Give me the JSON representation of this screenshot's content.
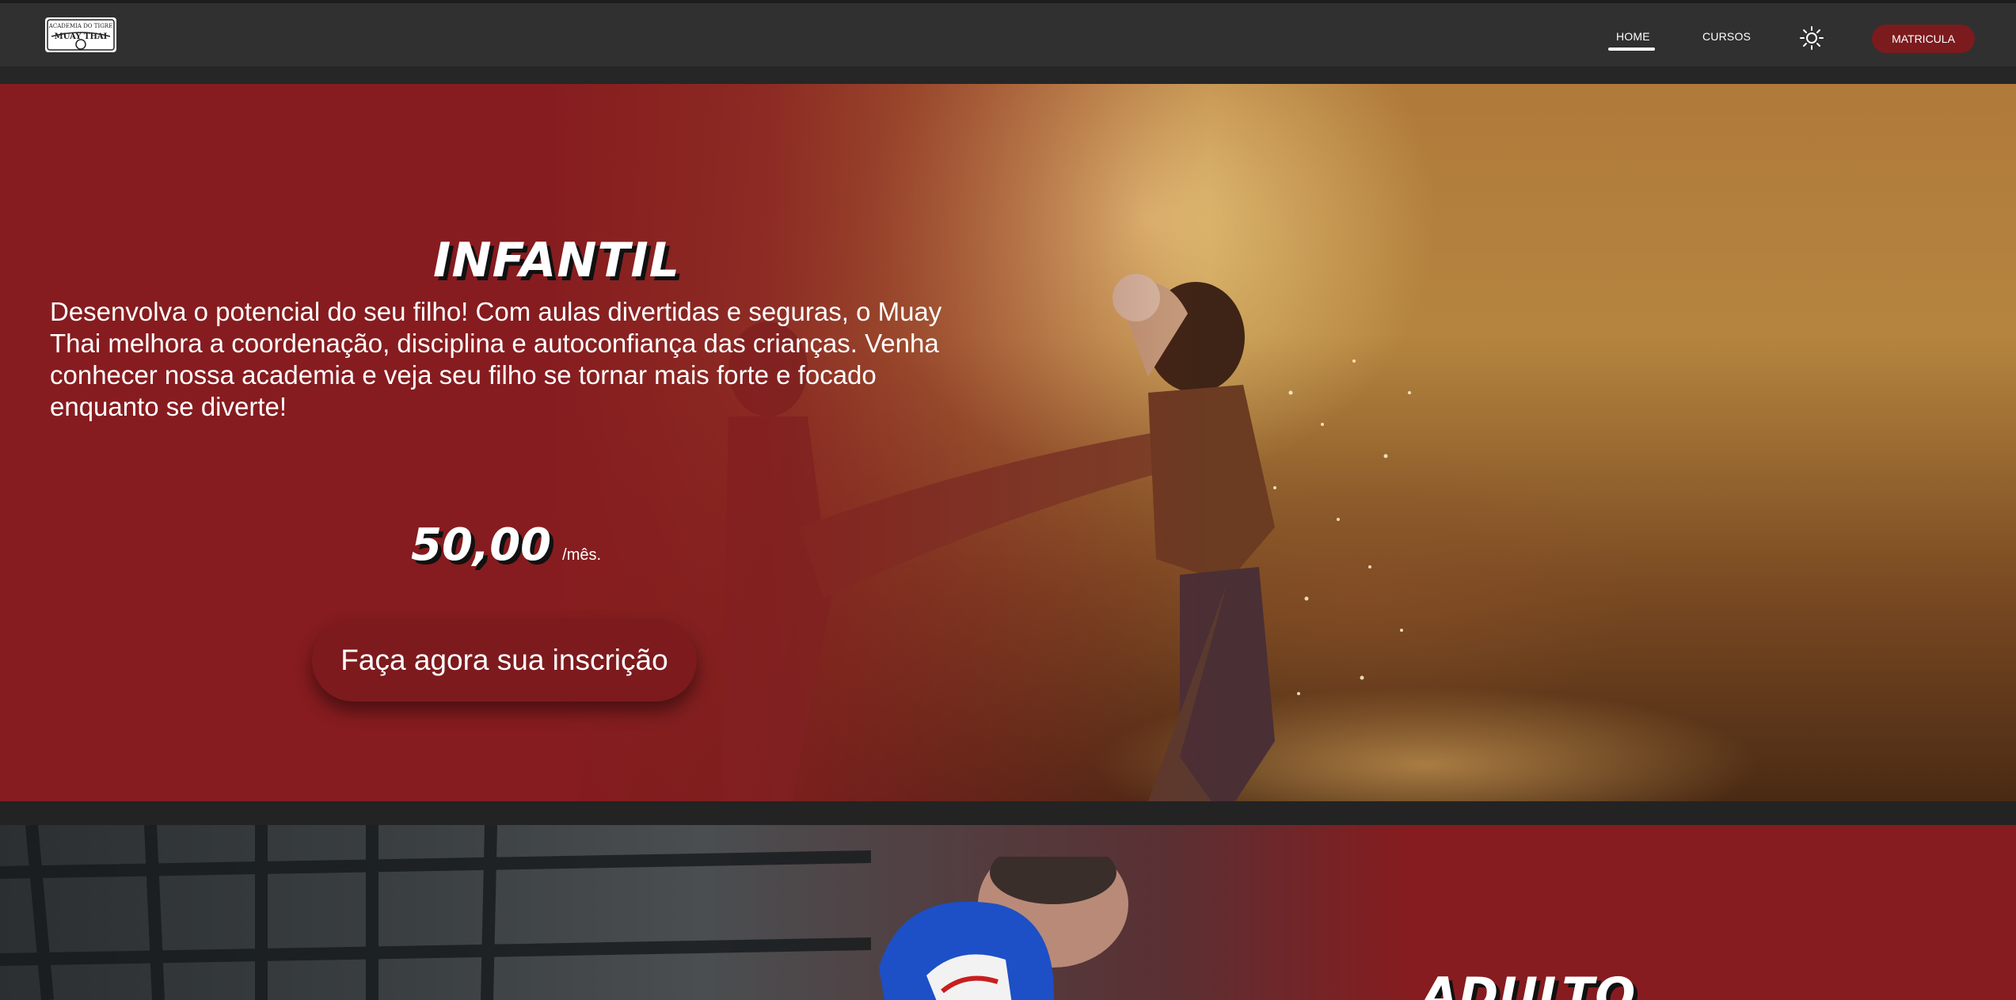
{
  "header": {
    "logo_top_text": "ACADEMIA DO TIGRE",
    "logo_main_text": "MUAY THAI",
    "nav": {
      "home_label": "HOME",
      "cursos_label": "CURSOS"
    },
    "theme_icon": "sun-icon",
    "cta_label": "MATRICULA"
  },
  "hero": {
    "title": "INFANTIL",
    "description": "Desenvolva o potencial do seu filho! Com aulas divertidas e seguras, o Muay Thai melhora a coordenação, disciplina e autoconfiança das crianças. Venha conhecer nossa academia e veja seu filho se tornar mais forte e focado enquanto se diverte!",
    "price": "50,00",
    "per_month": "/mês.",
    "cta_label": "Faça agora sua inscrição"
  },
  "section_two": {
    "title": "ADULTO"
  },
  "colors": {
    "brand_red": "#861c1f",
    "button_red": "#7d1a1d",
    "header_bg": "#303030",
    "page_bg": "#232323"
  }
}
